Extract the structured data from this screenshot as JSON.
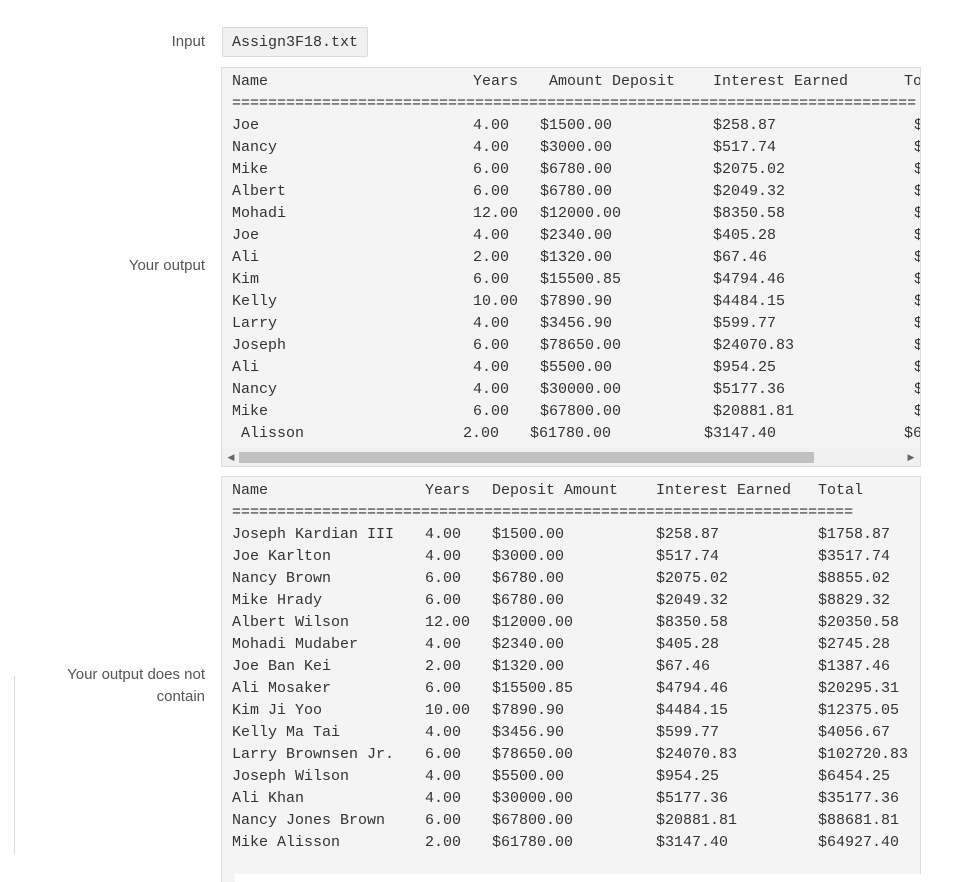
{
  "labels": {
    "input": "Input",
    "your_output": "Your output",
    "not_contain_line1": "Your output does not",
    "not_contain_line2": "contain"
  },
  "input_file": "Assign3F18.txt",
  "your_output": {
    "headers": [
      "Name",
      "Years",
      "Amount Deposit",
      "Interest Earned",
      "To"
    ],
    "separator": "============================================================================",
    "rows": [
      {
        "name": "Joe",
        "years": "4.00",
        "deposit": "$1500.00",
        "interest": "$258.87",
        "total": "$"
      },
      {
        "name": "Nancy",
        "years": "4.00",
        "deposit": "$3000.00",
        "interest": "$517.74",
        "total": "$"
      },
      {
        "name": "Mike",
        "years": "6.00",
        "deposit": "$6780.00",
        "interest": "$2075.02",
        "total": "$"
      },
      {
        "name": "Albert",
        "years": "6.00",
        "deposit": "$6780.00",
        "interest": "$2049.32",
        "total": "$"
      },
      {
        "name": "Mohadi",
        "years": "12.00",
        "deposit": "$12000.00",
        "interest": "$8350.58",
        "total": "$"
      },
      {
        "name": "Joe",
        "years": "4.00",
        "deposit": "$2340.00",
        "interest": "$405.28",
        "total": "$"
      },
      {
        "name": "Ali",
        "years": "2.00",
        "deposit": "$1320.00",
        "interest": "$67.46",
        "total": "$"
      },
      {
        "name": "Kim",
        "years": "6.00",
        "deposit": "$15500.85",
        "interest": "$4794.46",
        "total": "$"
      },
      {
        "name": "Kelly",
        "years": "10.00",
        "deposit": "$7890.90",
        "interest": "$4484.15",
        "total": "$"
      },
      {
        "name": "Larry",
        "years": "4.00",
        "deposit": "$3456.90",
        "interest": "$599.77",
        "total": "$"
      },
      {
        "name": "Joseph",
        "years": "6.00",
        "deposit": "$78650.00",
        "interest": "$24070.83",
        "total": "$"
      },
      {
        "name": "Ali",
        "years": "4.00",
        "deposit": "$5500.00",
        "interest": "$954.25",
        "total": "$"
      },
      {
        "name": "Nancy",
        "years": "4.00",
        "deposit": "$30000.00",
        "interest": "$5177.36",
        "total": "$"
      },
      {
        "name": "Mike",
        "years": "6.00",
        "deposit": "$67800.00",
        "interest": "$20881.81",
        "total": "$"
      },
      {
        "name": "Alisson",
        "years": "2.00",
        "deposit": "$61780.00",
        "interest": "$3147.40",
        "total": "$6"
      }
    ]
  },
  "expected_output": {
    "headers": [
      "Name",
      "Years",
      "Deposit Amount",
      "Interest Earned",
      "Total"
    ],
    "separator": "=====================================================================",
    "rows": [
      {
        "name": "Joseph Kardian III",
        "years": "4.00",
        "deposit": "$1500.00",
        "interest": "$258.87",
        "total": "$1758.87"
      },
      {
        "name": "Joe Karlton",
        "years": "4.00",
        "deposit": "$3000.00",
        "interest": "$517.74",
        "total": "$3517.74"
      },
      {
        "name": "Nancy Brown",
        "years": "6.00",
        "deposit": "$6780.00",
        "interest": "$2075.02",
        "total": "$8855.02"
      },
      {
        "name": "Mike Hrady",
        "years": "6.00",
        "deposit": "$6780.00",
        "interest": "$2049.32",
        "total": "$8829.32"
      },
      {
        "name": "Albert Wilson",
        "years": "12.00",
        "deposit": "$12000.00",
        "interest": "$8350.58",
        "total": "$20350.58"
      },
      {
        "name": "Mohadi Mudaber",
        "years": "4.00",
        "deposit": "$2340.00",
        "interest": "$405.28",
        "total": "$2745.28"
      },
      {
        "name": "Joe Ban Kei",
        "years": "2.00",
        "deposit": "$1320.00",
        "interest": "$67.46",
        "total": "$1387.46"
      },
      {
        "name": "Ali Mosaker",
        "years": "6.00",
        "deposit": "$15500.85",
        "interest": "$4794.46",
        "total": "$20295.31"
      },
      {
        "name": "Kim Ji Yoo",
        "years": "10.00",
        "deposit": "$7890.90",
        "interest": "$4484.15",
        "total": "$12375.05"
      },
      {
        "name": "Kelly Ma Tai",
        "years": "4.00",
        "deposit": "$3456.90",
        "interest": "$599.77",
        "total": "$4056.67"
      },
      {
        "name": "Larry Brownsen Jr.",
        "years": "6.00",
        "deposit": "$78650.00",
        "interest": "$24070.83",
        "total": "$102720.83"
      },
      {
        "name": "Joseph Wilson",
        "years": "4.00",
        "deposit": "$5500.00",
        "interest": "$954.25",
        "total": "$6454.25"
      },
      {
        "name": "Ali Khan",
        "years": "4.00",
        "deposit": "$30000.00",
        "interest": "$5177.36",
        "total": "$35177.36"
      },
      {
        "name": "Nancy Jones Brown",
        "years": "6.00",
        "deposit": "$67800.00",
        "interest": "$20881.81",
        "total": "$88681.81"
      },
      {
        "name": "Mike Alisson",
        "years": "2.00",
        "deposit": "$61780.00",
        "interest": "$3147.40",
        "total": "$64927.40"
      }
    ]
  },
  "icons": {
    "scroll_left": "caret-left-icon",
    "scroll_right": "caret-right-icon"
  }
}
